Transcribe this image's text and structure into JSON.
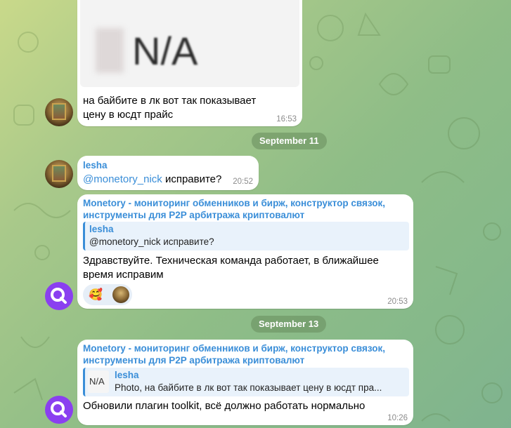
{
  "messages": [
    {
      "photo_text": "N/A",
      "text": "на байбите в лк вот так показывает цену в юсдт прайс",
      "time": "16:53"
    },
    {
      "date": "September 11",
      "sender": "lesha",
      "mention": "@monetory_nick",
      "text": " исправите?",
      "time": "20:52"
    },
    {
      "sender": "Monetory - мониторинг обменников и бирж, конструктор связок, инструменты для P2P арбитража криптовалют",
      "reply_name": "lesha",
      "reply_text": "@monetory_nick исправите?",
      "text": "Здравствуйте. Техническая команда работает, в ближайшее время исправим",
      "reaction_emoji": "🥰",
      "time": "20:53"
    },
    {
      "date": "September 13",
      "sender": "Monetory - мониторинг обменников и бирж, конструктор связок, инструменты для P2P арбитража криптовалют",
      "reply_name": "lesha",
      "reply_thumb_text": "N/A",
      "reply_text": "Photo, на байбите в лк вот так показывает цену в юсдт пра...",
      "text": "Обновили плагин toolkit, всё должно работать нормально",
      "time": "10:26"
    }
  ],
  "colors": {
    "accent": "#3a8ed8",
    "bubble": "#ffffff",
    "monetory_avatar": "#8a3ff0"
  }
}
